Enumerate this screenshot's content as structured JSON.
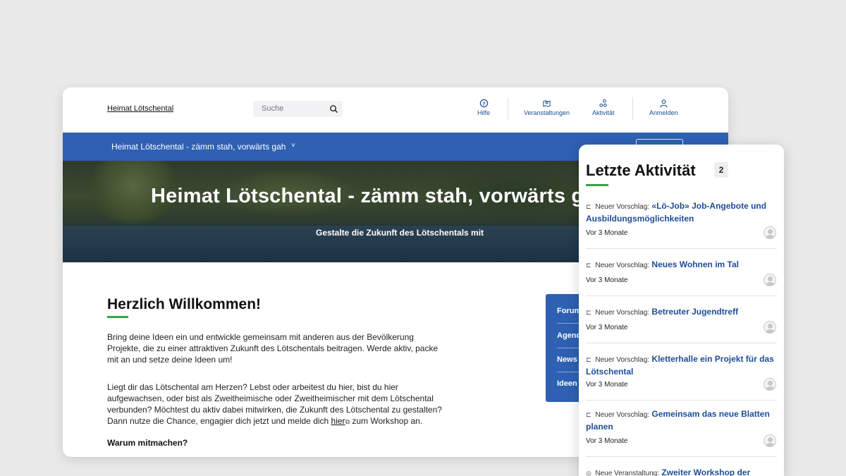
{
  "header": {
    "site_title": "Heimat Lötschental",
    "search_placeholder": "Suche",
    "nav": {
      "hilfe": "Hilfe",
      "veranstaltungen": "Veranstaltungen",
      "aktivitaet": "Aktivität",
      "anmelden": "Anmelden"
    }
  },
  "bluebar": {
    "title": "Heimat Lötschental - zämm stah, vorwärts gah",
    "chevron": "˅"
  },
  "hero": {
    "title": "Heimat Lötschental - zämm stah, vorwärts gah",
    "subtitle": "Gestalte die Zukunft des Lötschentals mit"
  },
  "main": {
    "heading": "Herzlich Willkommen!",
    "para1": "Bring deine Ideen ein und entwickle gemeinsam mit anderen aus der Bevölkerung Projekte, die zu einer attraktiven Zukunft des Lötschentals beitragen. Werde aktiv, packe mit an und setze deine Ideen um!",
    "para2_start": "Liegt dir das Lötschental am Herzen? Lebst oder arbeitest du hier, bist du hier aufgewachsen, oder bist als Zweitheimische oder Zweitheimischer mit dem Lötschental verbunden? Möchtest du aktiv dabei mitwirken, die Zukunft des Lötschental zu gestalten? Dann nutze die Chance, engagier dich jetzt und melde dich",
    "para2_link": "hier",
    "para2_end": "zum Workshop an.",
    "bold_line": "Warum mitmachen?"
  },
  "sidemenu": {
    "items": [
      "Forum",
      "Agenda",
      "News",
      "Ideen"
    ]
  },
  "activity": {
    "title": "Letzte Aktivität",
    "count": "2",
    "items": [
      {
        "kind": "Neuer Vorschlag:",
        "title": "«Lö-Job» Job-Angebote und Ausbildungsmöglichkeiten",
        "time": "Vor 3 Monate"
      },
      {
        "kind": "Neuer Vorschlag:",
        "title": "Neues Wohnen im Tal",
        "time": "Vor 3 Monate"
      },
      {
        "kind": "Neuer Vorschlag:",
        "title": "Betreuter Jugendtreff",
        "time": "Vor 3 Monate"
      },
      {
        "kind": "Neuer Vorschlag:",
        "title": "Kletterhalle ein Projekt für das Lötschental",
        "time": "Vor 3 Monate"
      },
      {
        "kind": "Neuer Vorschlag:",
        "title": "Gemeinsam das neue Blatten planen",
        "time": "Vor 3 Monate"
      },
      {
        "kind": "Neue Veranstaltung:",
        "title": "Zweiter Workshop der",
        "time": ""
      }
    ]
  }
}
